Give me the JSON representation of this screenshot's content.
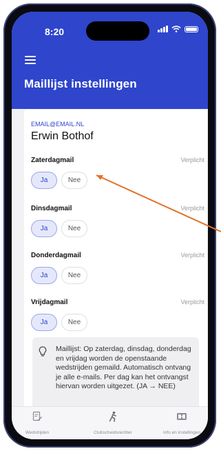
{
  "status_bar": {
    "time": "8:20"
  },
  "header": {
    "title": "Maillijst instellingen"
  },
  "user": {
    "email": "EMAIL@EMAIL.NL",
    "name": "Erwin Bothof"
  },
  "sections": [
    {
      "title": "Zaterdagmail",
      "required": "Verplicht",
      "yes": "Ja",
      "no": "Nee",
      "selected": "Ja"
    },
    {
      "title": "Dinsdagmail",
      "required": "Verplicht",
      "yes": "Ja",
      "no": "Nee",
      "selected": "Ja"
    },
    {
      "title": "Donderdagmail",
      "required": "Verplicht",
      "yes": "Ja",
      "no": "Nee",
      "selected": "Ja"
    },
    {
      "title": "Vrijdagmail",
      "required": "Verplicht",
      "yes": "Ja",
      "no": "Nee",
      "selected": "Ja"
    }
  ],
  "info": {
    "text": "Maillijst: Op zaterdag, dinsdag, donderdag en vrijdag worden de openstaande wedstrijden gemaild. Automatisch ontvang je alle e-mails. Per dag kan het ontvangst hiervan worden uitgezet. (JA → NEE)"
  },
  "bottom_nav": {
    "items": [
      {
        "label": "Wedstrijden",
        "icon": "edit-document-icon"
      },
      {
        "label": "Clubscheidsrechter",
        "icon": "referee-icon"
      },
      {
        "label": "Info en instellingen",
        "icon": "scoreboard-icon"
      }
    ]
  },
  "colors": {
    "primary": "#2f45cc",
    "annotation_arrow": "#e0732a"
  }
}
